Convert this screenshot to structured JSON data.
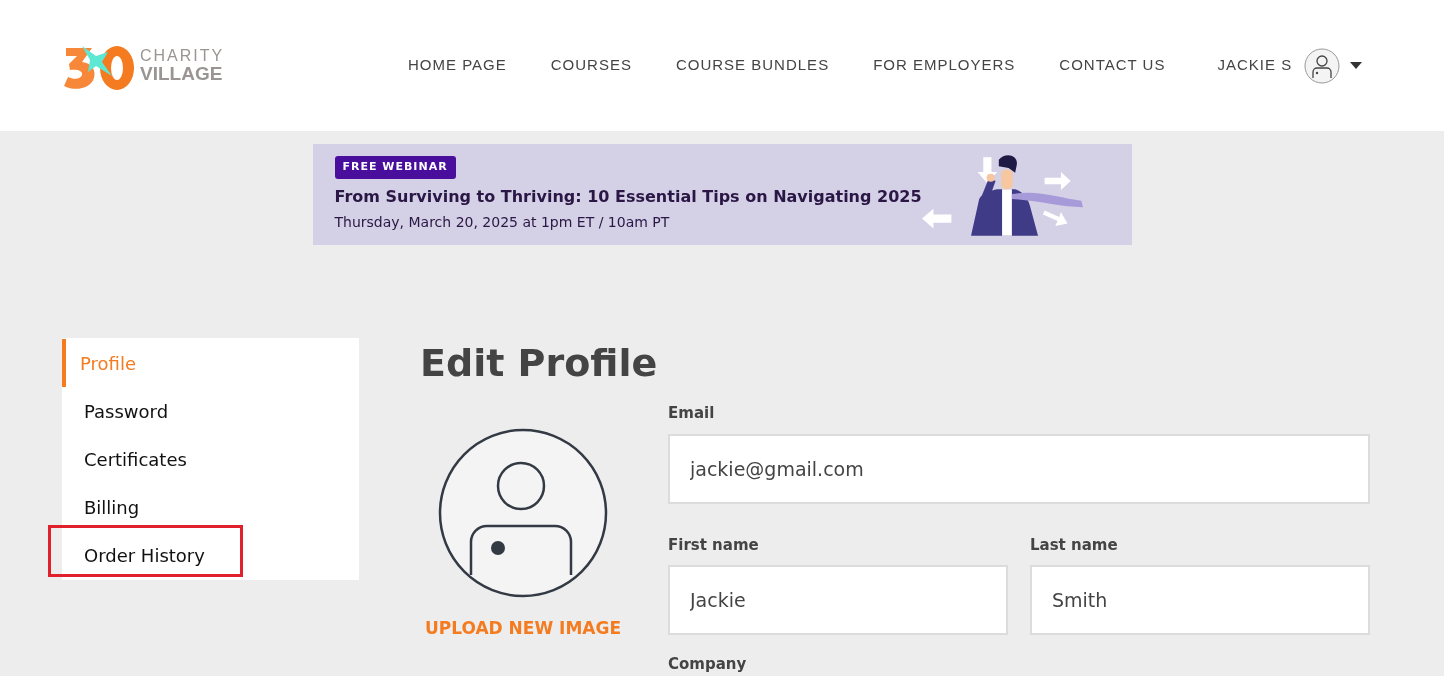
{
  "logo": {
    "line_1": "CHARITY",
    "line_2": "VILLAGE"
  },
  "nav": [
    {
      "label": "HOME PAGE"
    },
    {
      "label": "COURSES"
    },
    {
      "label": "COURSE BUNDLES"
    },
    {
      "label": "FOR EMPLOYERS"
    },
    {
      "label": "CONTACT US"
    }
  ],
  "user": {
    "name": "JACKIE S"
  },
  "banner": {
    "badge": "FREE WEBINAR",
    "title": "From Surviving to Thriving: 10 Essential Tips on Navigating 2025",
    "subtitle": "Thursday, March 20, 2025 at 1pm ET / 10am PT"
  },
  "sidebar": {
    "items": [
      {
        "label": "Profile",
        "selected": true,
        "highlighted": false
      },
      {
        "label": "Password",
        "selected": false,
        "highlighted": false
      },
      {
        "label": "Certificates",
        "selected": false,
        "highlighted": false
      },
      {
        "label": "Billing",
        "selected": false,
        "highlighted": false
      },
      {
        "label": "Order History",
        "selected": false,
        "highlighted": true
      }
    ]
  },
  "page_title": "Edit Profile",
  "upload_label": "UPLOAD NEW IMAGE",
  "fields": {
    "email": {
      "label": "Email",
      "value": "jackie@gmail.com"
    },
    "first_name": {
      "label": "First name",
      "value": "Jackie"
    },
    "last_name": {
      "label": "Last name",
      "value": "Smith"
    },
    "company": {
      "label": "Company"
    }
  }
}
